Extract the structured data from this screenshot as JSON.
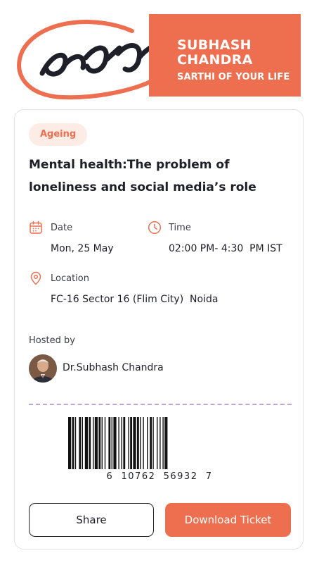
{
  "brand": {
    "name_line1": "SUBHASH",
    "name_line2": "CHANDRA",
    "tagline": "SARTHI OF YOUR LIFE",
    "color": "#ee6f4f"
  },
  "event": {
    "category": "Ageing",
    "title": "Mental health:The problem of loneliness and social media’s role",
    "date_label": "Date",
    "date_value": "Mon, 25 May",
    "time_label": "Time",
    "time_value": "02:00 PM- 4:30  PM IST",
    "location_label": "Location",
    "location_value": "FC-16 Sector 16 (Flim City)  Noida",
    "hosted_label": "Hosted by",
    "host_name": "Dr.Subhash Chandra"
  },
  "ticket": {
    "barcode_number": "6  10762  56932  7"
  },
  "actions": {
    "share_label": "Share",
    "download_label": "Download Ticket"
  },
  "icons": {
    "date": "calendar-icon",
    "time": "clock-icon",
    "location": "location-pin-icon"
  }
}
